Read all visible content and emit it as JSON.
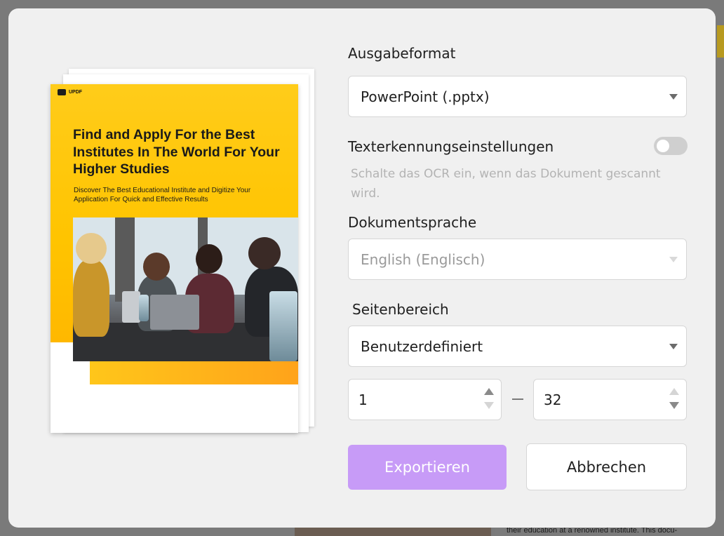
{
  "background": {
    "doc_snippet": "their education at a renowned institute. This docu-"
  },
  "preview": {
    "brand": "UPDF",
    "title": "Find and Apply For the Best Institutes In The World For Your Higher Studies",
    "subtitle": "Discover The Best Educational Institute and Digitize Your Application For Quick and Effective Results"
  },
  "form": {
    "output_format": {
      "label": "Ausgabeformat",
      "value": "PowerPoint (.pptx)"
    },
    "ocr": {
      "label": "Texterkennungseinstellungen",
      "enabled": false,
      "hint": "Schalte das OCR ein, wenn das Dokument gescannt wird."
    },
    "document_language": {
      "label": "Dokumentsprache",
      "value": "English (Englisch)",
      "disabled": true
    },
    "page_range": {
      "label": "Seitenbereich",
      "value": "Benutzerdefiniert",
      "from": "1",
      "to": "32"
    }
  },
  "buttons": {
    "export": "Exportieren",
    "cancel": "Abbrechen"
  },
  "colors": {
    "accent": "#c79bf7",
    "cover_yellow": "#ffc400"
  }
}
